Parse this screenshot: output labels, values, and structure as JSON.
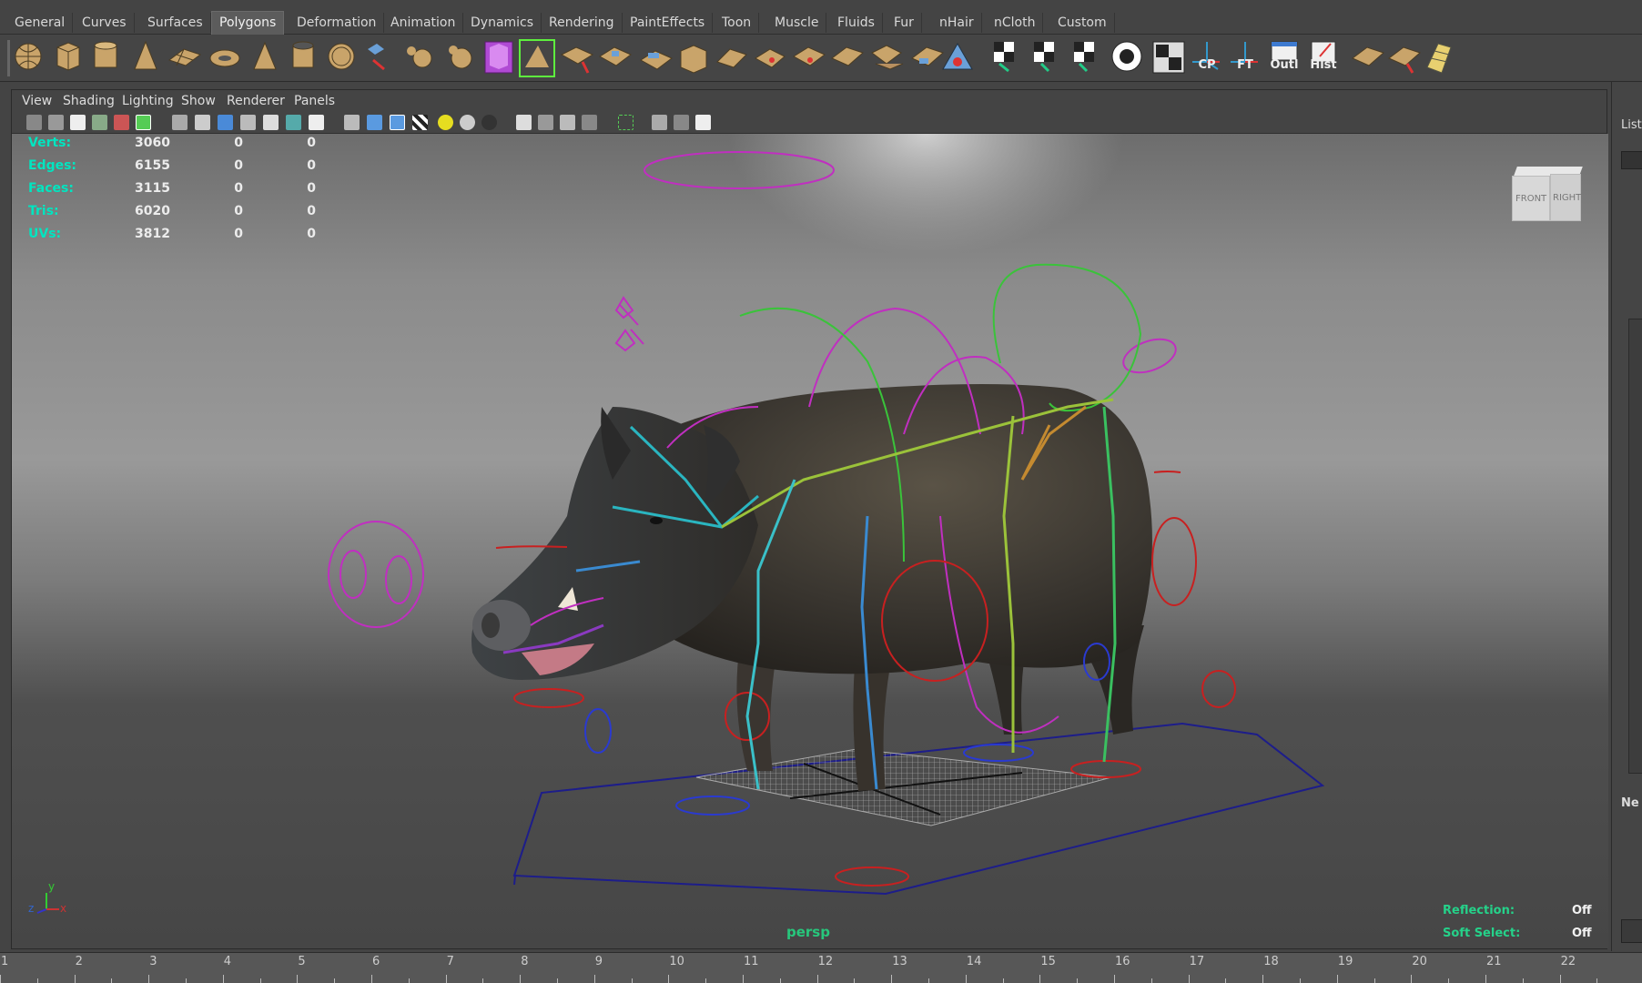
{
  "shelf_tabs": [
    "General",
    "Curves",
    "Surfaces",
    "Polygons",
    "Deformation",
    "Animation",
    "Dynamics",
    "Rendering",
    "PaintEffects",
    "Toon",
    "Muscle",
    "Fluids",
    "Fur",
    "nHair",
    "nCloth",
    "Custom"
  ],
  "active_shelf_tab": "Polygons",
  "shelf_labels": {
    "cp": "CP",
    "ft": "FT",
    "outl": "Outl",
    "hist": "Hist"
  },
  "panel_menu": [
    "View",
    "Shading",
    "Lighting",
    "Show",
    "Renderer",
    "Panels"
  ],
  "hud": {
    "stats": [
      {
        "label": "Verts:",
        "v1": "3060",
        "v2": "0",
        "v3": "0"
      },
      {
        "label": "Edges:",
        "v1": "6155",
        "v2": "0",
        "v3": "0"
      },
      {
        "label": "Faces:",
        "v1": "3115",
        "v2": "0",
        "v3": "0"
      },
      {
        "label": "Tris:",
        "v1": "6020",
        "v2": "0",
        "v3": "0"
      },
      {
        "label": "UVs:",
        "v1": "3812",
        "v2": "0",
        "v3": "0"
      }
    ],
    "reflection_label": "Reflection:",
    "reflection_value": "Off",
    "soft_select_label": "Soft Select:",
    "soft_select_value": "Off"
  },
  "camera_name": "persp",
  "view_cube": {
    "front": "FRONT",
    "right": "RIGHT"
  },
  "axis": {
    "y": "y",
    "z": "z",
    "x": "x"
  },
  "right_strip": {
    "top_label": "List",
    "bottom_label": "Ne"
  },
  "time_ticks": [
    "1",
    "2",
    "3",
    "4",
    "5",
    "6",
    "7",
    "8",
    "9",
    "10",
    "11",
    "12",
    "13",
    "14",
    "15",
    "16",
    "17",
    "18",
    "19",
    "20",
    "21",
    "22"
  ]
}
